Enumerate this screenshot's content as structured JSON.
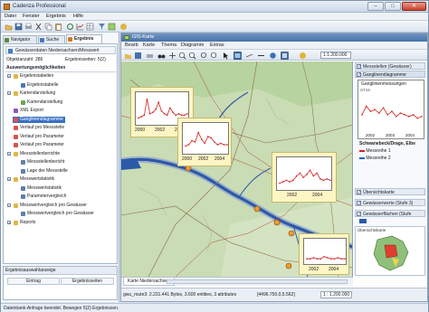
{
  "window": {
    "title": "Cadenza Professional",
    "min": "–",
    "max": "□",
    "close": "✕"
  },
  "menu": [
    "Datei",
    "Fenster",
    "Ergebnis",
    "Hilfe"
  ],
  "toolbar_icons": [
    "open-icon",
    "save-icon",
    "print-icon",
    "cut-icon",
    "copy-icon",
    "paste-icon",
    "refresh-icon",
    "chart-icon",
    "table-icon",
    "filter-icon",
    "map-icon",
    "help-icon"
  ],
  "left": {
    "tabs": [
      {
        "label": "Navigator"
      },
      {
        "label": "Suche"
      },
      {
        "label": "Ergebnis"
      }
    ],
    "source": "Gewässerdaten Niedersachsen/Messwert",
    "objektanzahl": "Objektanzahl: 286",
    "ergebnisseiten": "Ergebnisseiten: 5(2)",
    "section_title": "Auswertungsmöglichkeiten",
    "tree": [
      {
        "label": "Ergebnistabellen",
        "level": 0,
        "icon": "folder-icon",
        "expander": "−"
      },
      {
        "label": "Ergebnistabelle",
        "level": 1,
        "icon": "table-icon"
      },
      {
        "label": "Kartendarstellung",
        "level": 0,
        "icon": "folder-icon",
        "expander": "−"
      },
      {
        "label": "Kartendarstellung",
        "level": 1,
        "icon": "map-icon"
      },
      {
        "label": "XML Export",
        "level": 0,
        "icon": "xml-icon"
      },
      {
        "label": "Ganglinendiagramme",
        "level": 0,
        "icon": "chart-icon",
        "selected": true
      },
      {
        "label": "Verlauf pro Messstelle",
        "level": 0,
        "icon": "chart-icon"
      },
      {
        "label": "Verlauf pro Parameter",
        "level": 0,
        "icon": "chart-icon"
      },
      {
        "label": "Verlauf pro Parameter",
        "level": 0,
        "icon": "chart-icon"
      },
      {
        "label": "Messstellenberichte",
        "level": 0,
        "icon": "folder-icon",
        "expander": "−"
      },
      {
        "label": "Messstellenbericht",
        "level": 1,
        "icon": "report-icon"
      },
      {
        "label": "Lage der Messstelle",
        "level": 1,
        "icon": "report-icon"
      },
      {
        "label": "Messwertstatistik",
        "level": 0,
        "icon": "folder-icon",
        "expander": "−"
      },
      {
        "label": "Messwertstatistik",
        "level": 1,
        "icon": "report-icon"
      },
      {
        "label": "Parametervergleich",
        "level": 1,
        "icon": "report-icon"
      },
      {
        "label": "Messwertvergleich pro Gewässer",
        "level": 0,
        "icon": "folder-icon",
        "expander": "−"
      },
      {
        "label": "Messwertvergleich pro Gewässer",
        "level": 1,
        "icon": "report-icon"
      },
      {
        "label": "Reports",
        "level": 0,
        "icon": "folder-icon",
        "expander": "+"
      }
    ],
    "results": {
      "header": "Ergebnisauswahlanzeige",
      "col1": "Eintrag",
      "col2": "Ergebnisseiten"
    }
  },
  "gis": {
    "title": "GIS-Karte",
    "menu": [
      "Bearb",
      "Karte",
      "Thema",
      "Diagramm",
      "Extras"
    ],
    "scale_field": "1:1.200.000",
    "map_tab": "Karte Niedersachsen",
    "status": {
      "info": "gwu_route3: 2.231.441 Bytes, 3.600 entities, 3 attributes",
      "coords": "[4496.750,0,5.562]",
      "scale": "1 : 1.200.000"
    },
    "charts": [
      {
        "labels": [
          "2000",
          "2002",
          "2004"
        ],
        "values": [
          0.2,
          0.25,
          0.3,
          0.85,
          0.35,
          0.4,
          0.5,
          0.75,
          0.45,
          0.35,
          0.3,
          0.55,
          0.4,
          0.3,
          0.35,
          0.3,
          0.3,
          0.35
        ]
      },
      {
        "labels": [
          "2000",
          "2002",
          "2004"
        ],
        "values": [
          0.25,
          0.3,
          0.45,
          0.4,
          0.75,
          0.5,
          0.35,
          0.6,
          0.55,
          0.4,
          0.3,
          0.35,
          0.3,
          0.3
        ]
      },
      {
        "labels": [
          "2002",
          "2004"
        ],
        "values": [
          0.2,
          0.25,
          0.3,
          0.25,
          0.3,
          0.45,
          0.55,
          0.4,
          0.5,
          0.65,
          0.45,
          0.55,
          0.35,
          0.3,
          0.35,
          0.3
        ]
      },
      {
        "labels": [
          "2002",
          "2004"
        ],
        "values": [
          0.2,
          0.2,
          0.25,
          0.2,
          0.2,
          0.3,
          0.25,
          0.2,
          0.2,
          0.25,
          0.2,
          0.2
        ]
      }
    ]
  },
  "legend": {
    "layer1": "Messstellen (Gewässer)",
    "layer2": "Ganglinendiagramme",
    "graph_title": "Ganglinienmessungen",
    "graph_ylabel": "ST19",
    "graph_values": [
      0.45,
      0.7,
      0.55,
      0.6,
      0.5,
      0.65,
      0.45,
      0.55,
      0.4,
      0.5,
      0.45,
      0.4,
      0.45,
      0.35,
      0.4
    ],
    "graph_labels": [
      "2002",
      "2003",
      "2004"
    ],
    "station": "Schwanebeck/Drage, Elbe",
    "items": [
      {
        "label": "Messreihe 1",
        "color": "#d32020"
      },
      {
        "label": "Messreihe 2",
        "color": "#2060c8"
      }
    ],
    "layer3": "Übersichtskarte",
    "layer4": "Gewässerwerte (Stufe 3)",
    "layer5": "Gewässerflächen (Stufe",
    "overview_title": "Übersichtskarte"
  },
  "app_status": "Datenbank-Anfrage beendet. Bewegen 5(2) Ergebnissen."
}
